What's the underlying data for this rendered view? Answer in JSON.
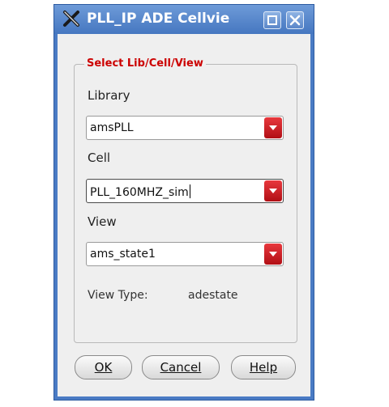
{
  "window": {
    "title": "PLL_IP ADE Cellvie",
    "accent": "#4a7bc4"
  },
  "titlebar_icons": {
    "app": "x-logo-icon",
    "maximize": "maximize-icon",
    "close": "close-icon"
  },
  "group": {
    "title": "Select Lib/Cell/View",
    "title_color": "#cc0000"
  },
  "library": {
    "label": "Library",
    "value": "amsPLL"
  },
  "cell": {
    "label": "Cell",
    "value": "PLL_160MHZ_sim"
  },
  "view": {
    "label": "View",
    "value": "ams_state1"
  },
  "view_type": {
    "label": "View Type:",
    "value": "adestate"
  },
  "buttons": {
    "ok": "OK",
    "cancel": "Cancel",
    "help": "Help"
  },
  "dropdown_arrow_color": "#c8141a"
}
